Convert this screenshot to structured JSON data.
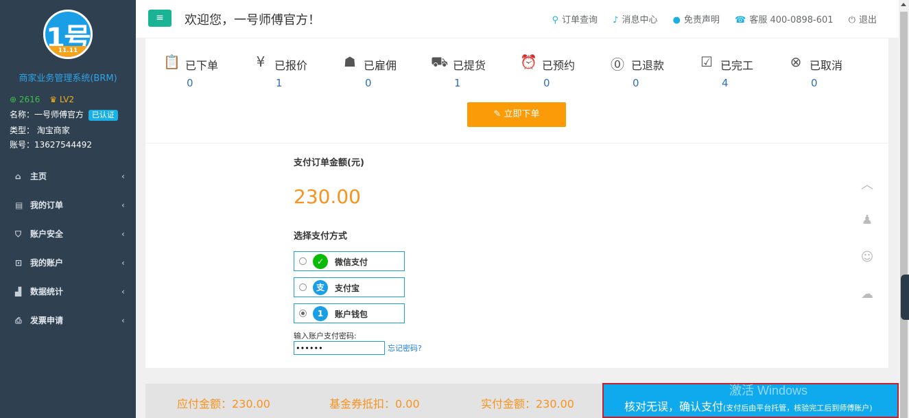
{
  "sidebar": {
    "logo_text": "1号",
    "logo_band": "11.11",
    "system_name": "商家业务管理系统(BRM)",
    "coins": "2616",
    "level": "LV2",
    "name_line": "名称：一号师傅官方",
    "verified": "已认证",
    "type_line": "类型： 淘宝商家",
    "account_line": "账号：13627544492",
    "nav": [
      {
        "label": "主页",
        "icon": "home-icon"
      },
      {
        "label": "我的订单",
        "icon": "list-icon"
      },
      {
        "label": "账户安全",
        "icon": "shield-icon"
      },
      {
        "label": "我的账户",
        "icon": "account-icon"
      },
      {
        "label": "数据统计",
        "icon": "bar-chart-icon"
      },
      {
        "label": "发票申请",
        "icon": "printer-icon"
      }
    ]
  },
  "header": {
    "welcome": "欢迎您，一号师傅官方！",
    "links": {
      "order_query": "订单查询",
      "messages": "消息中心",
      "disclaimer": "免责声明",
      "service": "客服 400-0898-601",
      "logout": "退出"
    }
  },
  "status": [
    {
      "label": "已下单",
      "count": "0",
      "icon": "clipboard-check-icon"
    },
    {
      "label": "已报价",
      "count": "1",
      "icon": "quote-yen-icon"
    },
    {
      "label": "已雇佣",
      "count": "0",
      "icon": "worker-icon"
    },
    {
      "label": "已提货",
      "count": "1",
      "icon": "truck-icon"
    },
    {
      "label": "已预约",
      "count": "0",
      "icon": "alarm-clock-icon"
    },
    {
      "label": "已退款",
      "count": "0",
      "icon": "refund-icon"
    },
    {
      "label": "已完工",
      "count": "4",
      "icon": "clipboard-done-icon"
    },
    {
      "label": "已取消",
      "count": "0",
      "icon": "cancel-icon"
    }
  ],
  "order_now": "立即下单",
  "payment": {
    "amount_label": "支付订单金额(元)",
    "amount": "230.00",
    "method_label": "选择支付方式",
    "methods": [
      {
        "label": "微信支付",
        "icon": "wechat-pay-icon",
        "color": "#09bb07",
        "glyph": "✓",
        "selected": false
      },
      {
        "label": "支付宝",
        "icon": "alipay-icon",
        "color": "#1a9ee6",
        "glyph": "支",
        "selected": false
      },
      {
        "label": "账户钱包",
        "icon": "wallet-icon",
        "color": "#1a9ee6",
        "glyph": "1",
        "selected": true
      }
    ],
    "password_label": "输入账户支付密码:",
    "password_value": "••••••",
    "forgot": "忘记密码?"
  },
  "summary": {
    "payable": "应付金额：230.00",
    "voucher": "基金券抵扣：0.00",
    "actual": "实付金额：230.00",
    "confirm_main": "核对无误，确认支付",
    "confirm_sub": "(支付后由平台托管，核验完工后到师傅账户)"
  },
  "watermark": "激活 Windows",
  "colors": {
    "sidebar": "#2f4050",
    "accent": "#1ab394",
    "orange": "#fb9b08",
    "confirm": "#0fa9ee"
  }
}
